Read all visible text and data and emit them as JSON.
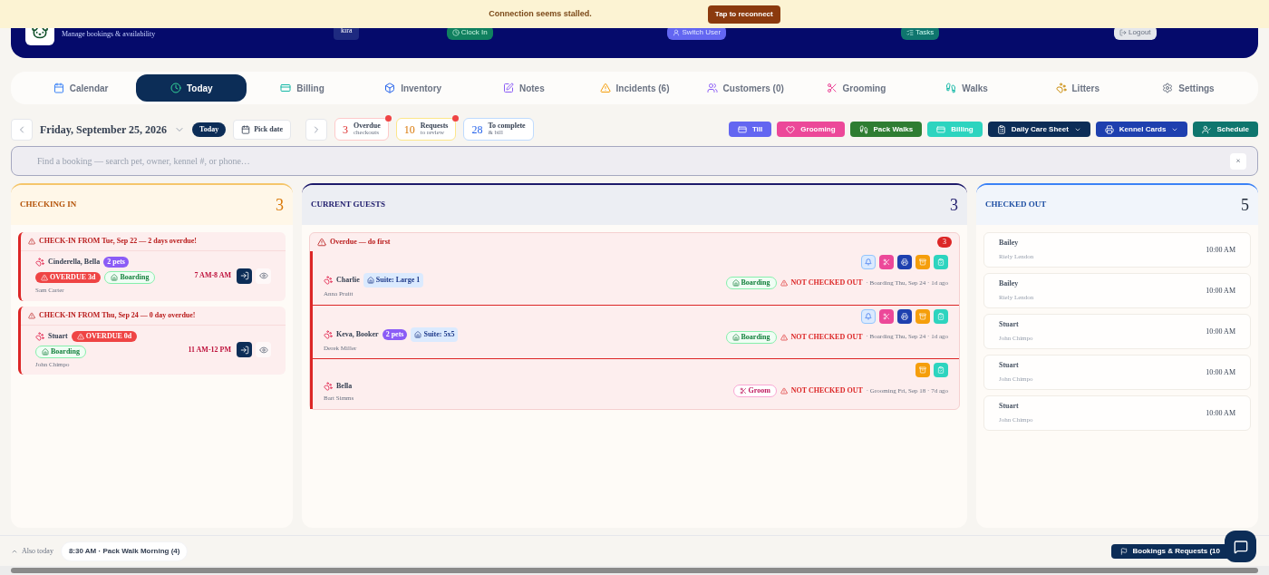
{
  "banner": {
    "message": "Connection seems stalled.",
    "action": "Tap to reconnect"
  },
  "header": {
    "subtitle": "Manage bookings & availability",
    "user": "kira",
    "buttons": [
      {
        "label": "Clock In",
        "kind": "clock"
      },
      {
        "label": "Switch User",
        "kind": "switch"
      },
      {
        "label": "Tasks",
        "kind": "tasks"
      },
      {
        "label": "Logout",
        "kind": "logout"
      }
    ]
  },
  "tabs": [
    {
      "label": "Calendar",
      "selected": false
    },
    {
      "label": "Today",
      "selected": true
    },
    {
      "label": "Billing",
      "selected": false
    },
    {
      "label": "Inventory",
      "selected": false
    },
    {
      "label": "Notes",
      "selected": false
    },
    {
      "label": "Incidents (6)",
      "selected": false
    },
    {
      "label": "Customers (0)",
      "selected": false
    },
    {
      "label": "Grooming",
      "selected": false
    },
    {
      "label": "Walks",
      "selected": false
    },
    {
      "label": "Litters",
      "selected": false
    },
    {
      "label": "Settings",
      "selected": false
    }
  ],
  "date_nav": {
    "date": "Friday, September 25, 2026",
    "today": "Today",
    "pick": "Pick date"
  },
  "stats": [
    {
      "count": "3",
      "label": "Overdue",
      "sub": "checkouts",
      "kind": "overdue",
      "alert": true
    },
    {
      "count": "10",
      "label": "Requests",
      "sub": "to review",
      "kind": "requests",
      "alert": true
    },
    {
      "count": "28",
      "label": "To complete",
      "sub": "& bill",
      "kind": "complete",
      "alert": false
    }
  ],
  "actions": [
    {
      "label": "Till",
      "kind": "till",
      "dropdown": false
    },
    {
      "label": "Grooming",
      "kind": "grooming",
      "dropdown": false
    },
    {
      "label": "Pack Walks",
      "kind": "walks",
      "dropdown": false
    },
    {
      "label": "Billing",
      "kind": "billing",
      "dropdown": false
    },
    {
      "label": "Daily Care Sheet",
      "kind": "care",
      "dropdown": true
    },
    {
      "label": "Kennel Cards",
      "kind": "kennel",
      "dropdown": true
    },
    {
      "label": "Schedule",
      "kind": "schedule",
      "dropdown": false
    }
  ],
  "search": {
    "placeholder": "Find a booking — search pet, owner, kennel #, or phone…",
    "clear": "×"
  },
  "checking_in": {
    "title": "CHECKING IN",
    "count": "3",
    "bookings": [
      {
        "alert": "CHECK-IN FROM Tue, Sep 22 — 2 days overdue!",
        "name": "Cinderella, Bella",
        "pets": "2 pets",
        "overdue": "OVERDUE 3d",
        "service": {
          "label": "Boarding",
          "kind": "boarding"
        },
        "owner": "Sam Carter",
        "time": "7 AM-8 AM"
      },
      {
        "alert": "CHECK-IN FROM Thu, Sep 24 — 0 day overdue!",
        "name": "Stuart",
        "overdue": "OVERDUE 0d",
        "service": {
          "label": "Boarding",
          "kind": "boarding"
        },
        "owner": "John Chimpo",
        "time": "11 AM-12 PM"
      }
    ]
  },
  "current": {
    "title": "CURRENT GUESTS",
    "count": "3",
    "group": {
      "title": "Overdue — do first",
      "count": "3",
      "guests": [
        {
          "name": "Charlie",
          "suite": "Suite: Large 1",
          "owner": "Anna Pruitt",
          "service": {
            "label": "Boarding",
            "kind": "boarding"
          },
          "status": "NOT CHECKED OUT",
          "detail": "· Boarding Thu, Sep 24 · 1d ago",
          "actions": [
            {
              "kind": "bell"
            },
            {
              "kind": "groom"
            },
            {
              "kind": "print"
            },
            {
              "kind": "box"
            },
            {
              "kind": "clip"
            }
          ]
        },
        {
          "name": "Keva, Booker",
          "pets": "2 pets",
          "suite": "Suite: 5x5",
          "owner": "Derek Miller",
          "service": {
            "label": "Boarding",
            "kind": "boarding"
          },
          "status": "NOT CHECKED OUT",
          "detail": "· Boarding Thu, Sep 24 · 1d ago",
          "actions": [
            {
              "kind": "bell"
            },
            {
              "kind": "groom"
            },
            {
              "kind": "print"
            },
            {
              "kind": "box"
            },
            {
              "kind": "clip"
            }
          ]
        },
        {
          "name": "Bella",
          "owner": "Bart Simms",
          "service": {
            "label": "Groom",
            "kind": "groom"
          },
          "status": "NOT CHECKED OUT",
          "detail": "· Grooming Fri, Sep 18 · 7d ago",
          "actions": [
            {
              "kind": "box"
            },
            {
              "kind": "clip"
            }
          ]
        }
      ]
    }
  },
  "checked_out": {
    "title": "CHECKED OUT",
    "count": "5",
    "items": [
      {
        "name": "Bailey",
        "owner": "Riely Lendon",
        "time": "10:00 AM"
      },
      {
        "name": "Bailey",
        "owner": "Riely Lendon",
        "time": "10:00 AM"
      },
      {
        "name": "Stuart",
        "owner": "John Chimpo",
        "time": "10:00 AM"
      },
      {
        "name": "Stuart",
        "owner": "John Chimpo",
        "time": "10:00 AM"
      },
      {
        "name": "Stuart",
        "owner": "John Chimpo",
        "time": "10:00 AM"
      }
    ]
  },
  "footer": {
    "also": "Also today",
    "event": "8:30 AM · Pack Walk Morning (4)",
    "requests": "Bookings & Requests (10"
  }
}
